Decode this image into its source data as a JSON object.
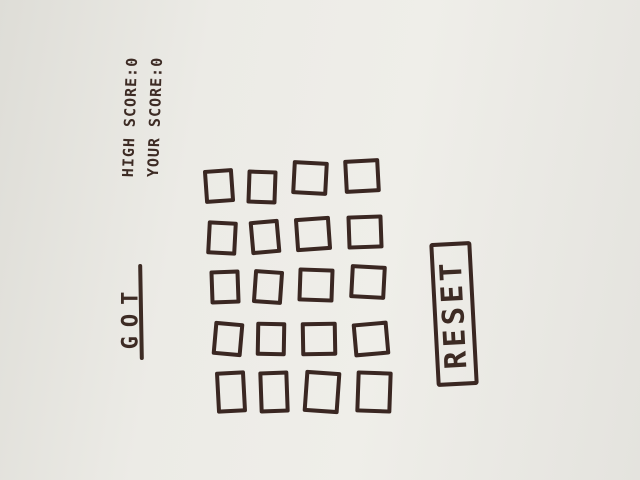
{
  "title": "GOT",
  "scores": {
    "high_label": "HIGH SCORE:0",
    "your_label": "YOUR SCORE:0"
  },
  "grid": {
    "columns": 4,
    "rows": 5,
    "cell_count": 20
  },
  "reset_label": "RESET",
  "colors": {
    "ink": "#3d2b24",
    "paper": "#ecebe6"
  }
}
